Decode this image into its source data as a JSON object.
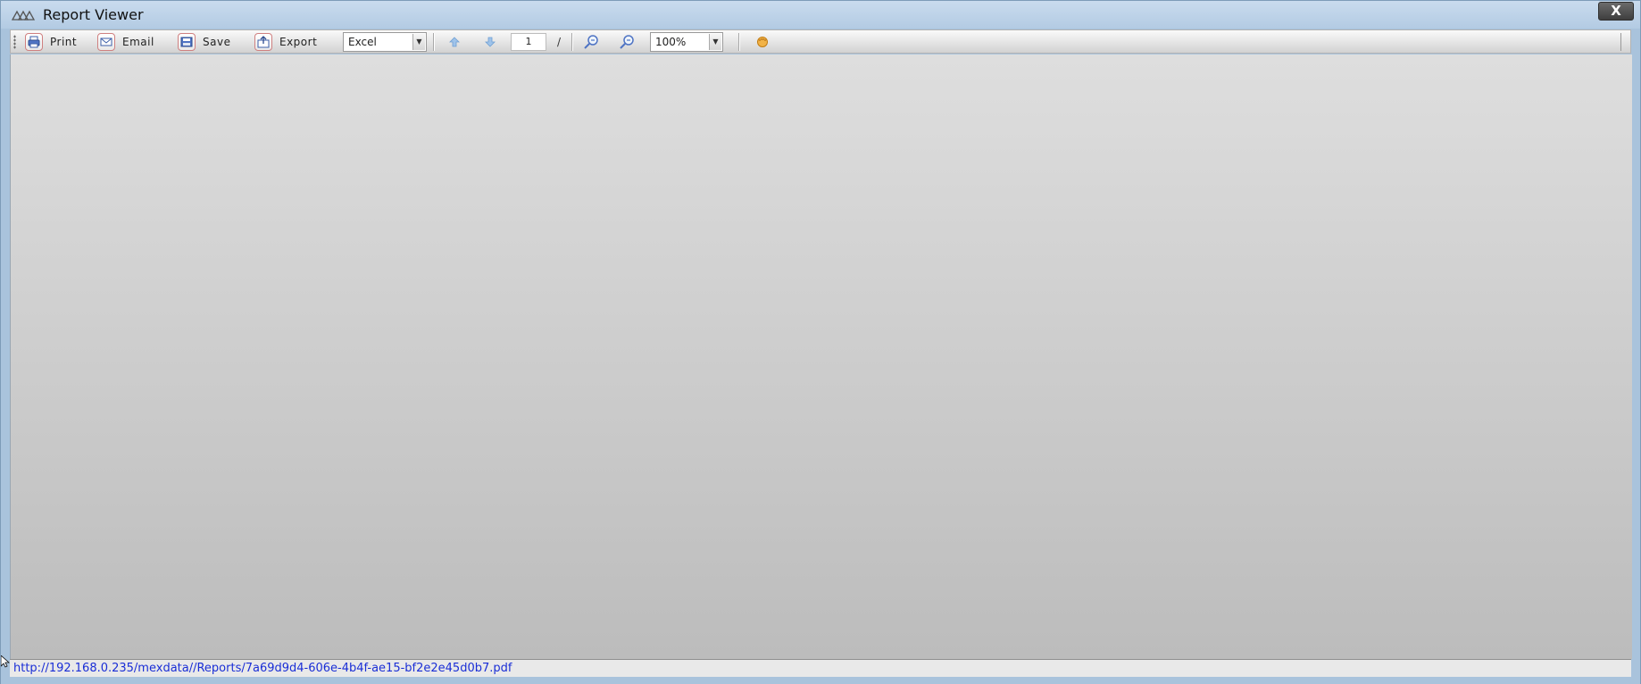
{
  "window": {
    "title": "Report Viewer",
    "close_label": "X"
  },
  "toolbar": {
    "print_label": "Print",
    "email_label": "Email",
    "save_label": "Save",
    "export_label": "Export",
    "export_format": "Excel",
    "page_number": "1",
    "page_separator": "/",
    "zoom_level": "100%",
    "icons": {
      "print": "printer-icon",
      "email": "envelope-icon",
      "save": "save-icon",
      "export": "export-icon",
      "prev_page": "arrow-up-icon",
      "next_page": "arrow-down-icon",
      "zoom_in": "zoom-in-icon",
      "zoom_out": "zoom-out-icon",
      "pan": "hand-icon"
    }
  },
  "status": {
    "url": "http://192.168.0.235/mexdata//Reports/7a69d9d4-606e-4b4f-ae15-bf2e2e45d0b7.pdf"
  },
  "colors": {
    "titlebar": "#b3cbe3",
    "link": "#1a2ed6",
    "icon_accent": "#cf8080"
  }
}
